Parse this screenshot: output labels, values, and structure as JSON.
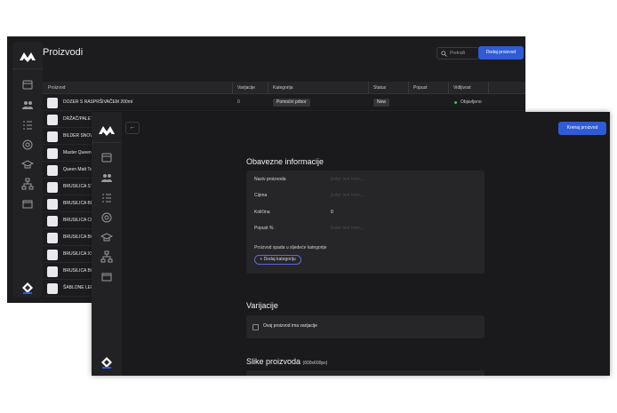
{
  "back": {
    "title": "Proizvodi",
    "search_placeholder": "Pretraži",
    "add_button": "Dodaj proizvod",
    "columns": [
      "Proizvod",
      "Varijacije",
      "Kategorija",
      "Status",
      "Popust",
      "Vidljivost"
    ],
    "rows": [
      {
        "name": "DOZER S RASPRŠIVAČEM 200ml",
        "variations": "0",
        "category": "Pomoćni pribor",
        "status": "New",
        "visibility": "Objavljeno"
      },
      {
        "name": "DRŽAČ/PALET",
        "variations": "",
        "category": "",
        "status": "",
        "visibility": ""
      },
      {
        "name": "BILDER SNOW",
        "variations": "",
        "category": "",
        "status": "",
        "visibility": ""
      },
      {
        "name": "Master Queen",
        "variations": "",
        "category": "",
        "status": "",
        "visibility": ""
      },
      {
        "name": "Queen Matt To",
        "variations": "",
        "category": "",
        "status": "",
        "visibility": ""
      },
      {
        "name": "BRUSILICA ST",
        "variations": "",
        "category": "",
        "status": "",
        "visibility": ""
      },
      {
        "name": "BRUSILICA BL",
        "variations": "",
        "category": "",
        "status": "",
        "visibility": ""
      },
      {
        "name": "BRUSILICA CR",
        "variations": "",
        "category": "",
        "status": "",
        "visibility": ""
      },
      {
        "name": "BRUSILICA BQ",
        "variations": "",
        "category": "",
        "status": "",
        "visibility": ""
      },
      {
        "name": "BRUSILICA XS",
        "variations": "",
        "category": "",
        "status": "",
        "visibility": ""
      },
      {
        "name": "BRUSILICA BQ",
        "variations": "",
        "category": "",
        "status": "",
        "visibility": ""
      },
      {
        "name": "ŠABLONE LEP",
        "variations": "",
        "category": "",
        "status": "",
        "visibility": ""
      }
    ]
  },
  "front": {
    "back_arrow": "←",
    "create_button": "Kreiraj proizvod",
    "required_title": "Obavezne informacije",
    "fields": [
      {
        "label": "Naziv proizvoda",
        "value": "",
        "placeholder": "Enter text here..."
      },
      {
        "label": "Cijena",
        "value": "",
        "placeholder": "Enter text here..."
      },
      {
        "label": "Količina",
        "value": "0",
        "placeholder": ""
      },
      {
        "label": "Popust %",
        "value": "",
        "placeholder": "Enter text here..."
      }
    ],
    "category_prompt": "Proizvod spada u sljedeće kategorije",
    "add_category": "+ Dodaj kategoriju",
    "variations_title": "Varijacije",
    "variations_checkbox": "Ovaj proizvod ima varijacije",
    "images_title": "Slike proizvoda",
    "images_hint": "(600x600px)"
  },
  "colors": {
    "accent": "#2f5bd6",
    "published": "#3ac060",
    "bg": "#1c1c1e"
  }
}
